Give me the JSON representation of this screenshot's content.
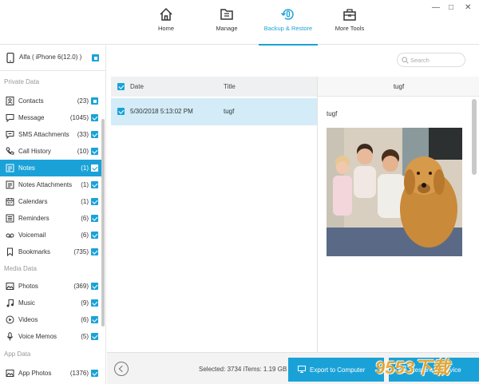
{
  "window": {
    "minimize": "—",
    "maximize": "□",
    "close": "✕"
  },
  "nav": [
    {
      "label": "Home",
      "icon": "home-icon"
    },
    {
      "label": "Manage",
      "icon": "folder-icon"
    },
    {
      "label": "Backup & Restore",
      "icon": "backup-restore-icon",
      "active": true
    },
    {
      "label": "More Tools",
      "icon": "toolbox-icon"
    }
  ],
  "device": {
    "name": "Alfa ( iPhone 6(12.0) )"
  },
  "sections": {
    "private": "Private Data",
    "media": "Media Data",
    "app": "App Data"
  },
  "items": [
    {
      "label": "Contacts",
      "count": "(23)",
      "icon": "contacts-icon"
    },
    {
      "label": "Message",
      "count": "(1045)",
      "icon": "message-icon"
    },
    {
      "label": "SMS Attachments",
      "count": "(33)",
      "icon": "sms-attachment-icon"
    },
    {
      "label": "Call History",
      "count": "(10)",
      "icon": "phone-icon"
    },
    {
      "label": "Notes",
      "count": "(1)",
      "icon": "notes-icon",
      "active": true
    },
    {
      "label": "Notes Attachments",
      "count": "(1)",
      "icon": "notes-attachment-icon"
    },
    {
      "label": "Calendars",
      "count": "(1)",
      "icon": "calendar-icon"
    },
    {
      "label": "Reminders",
      "count": "(6)",
      "icon": "reminders-icon"
    },
    {
      "label": "Voicemail",
      "count": "(6)",
      "icon": "voicemail-icon"
    },
    {
      "label": "Bookmarks",
      "count": "(735)",
      "icon": "bookmark-icon"
    },
    {
      "label": "Photos",
      "count": "(369)",
      "icon": "photos-icon"
    },
    {
      "label": "Music",
      "count": "(9)",
      "icon": "music-icon"
    },
    {
      "label": "Videos",
      "count": "(6)",
      "icon": "video-icon"
    },
    {
      "label": "Voice Memos",
      "count": "(5)",
      "icon": "microphone-icon"
    },
    {
      "label": "App Photos",
      "count": "(1376)",
      "icon": "app-photos-icon"
    }
  ],
  "search": {
    "placeholder": "Search"
  },
  "table": {
    "headers": {
      "date": "Date",
      "title": "Title"
    },
    "rows": [
      {
        "date": "5/30/2018 5:13:02 PM",
        "title": "tugf"
      }
    ]
  },
  "detail": {
    "header": "tugf",
    "title": "tugf"
  },
  "footer": {
    "selected": "Selected: 3734 iTems: 1.19 GB",
    "export": "Export to Computer",
    "restore": "Restore to Device"
  },
  "watermark": "9553下载",
  "colors": {
    "accent": "#1aa2d8",
    "row_selected": "#d3ecf7"
  }
}
